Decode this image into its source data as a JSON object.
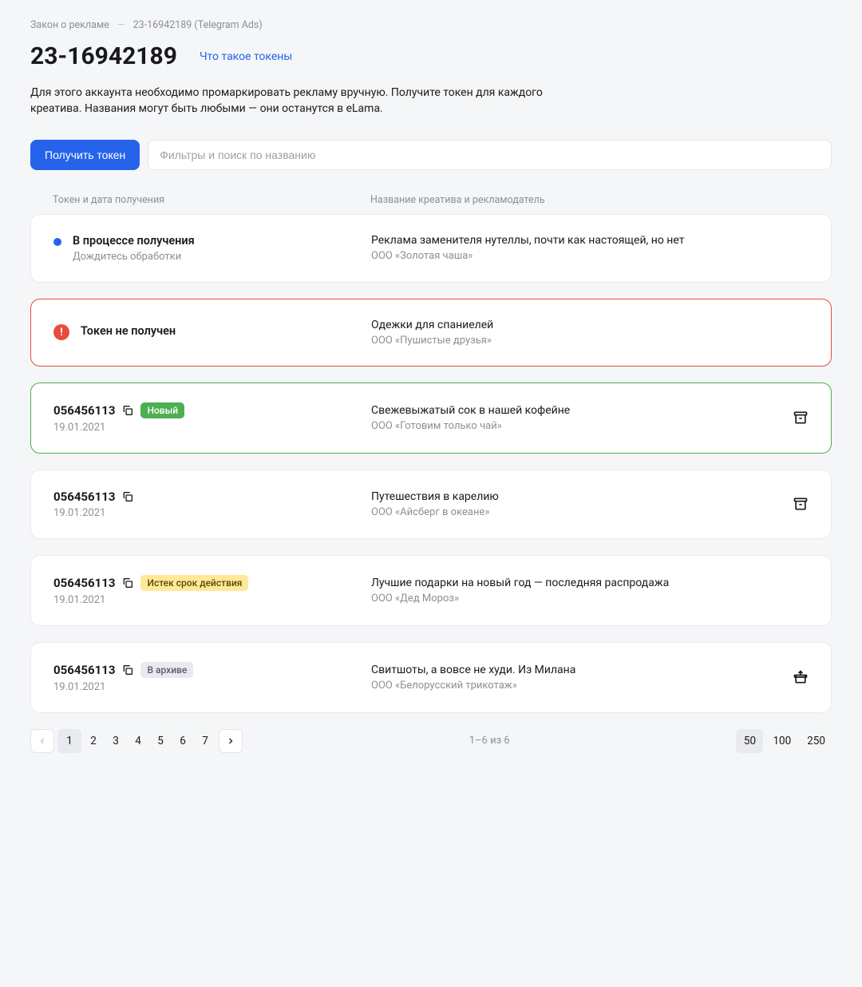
{
  "breadcrumb": {
    "root": "Закон о рекламе",
    "current": "23-16942189 (Telegram Ads)"
  },
  "header": {
    "title": "23-16942189",
    "help_link": "Что такое токены",
    "description": "Для этого аккаунта необходимо промаркировать рекламу вручную. Получите токен для каждого креатива. Названия могут быть любыми — они останутся в eLama."
  },
  "controls": {
    "get_token_label": "Получить токен",
    "search_placeholder": "Фильтры и поиск по названию"
  },
  "columns": {
    "token": "Токен и дата получения",
    "creative": "Название креатива и рекламодатель"
  },
  "rows": [
    {
      "state": "pending",
      "title": "В процессе получения",
      "subtitle": "Дождитесь обработки",
      "creative": "Реклама заменителя нутеллы, почти как настоящей, но нет",
      "advertiser": "ООО «Золотая чаша»",
      "action": null
    },
    {
      "state": "error",
      "title": "Токен не получен",
      "subtitle": "",
      "creative": "Одежки для спаниелей",
      "advertiser": "ООО «Пушистые друзья»",
      "action": null
    },
    {
      "state": "new",
      "token": "056456113",
      "date": "19.01.2021",
      "badge": "Новый",
      "creative": "Свежевыжатый сок в нашей кофейне",
      "advertiser": "ООО «Готовим только чай»",
      "action": "archive"
    },
    {
      "state": "normal",
      "token": "056456113",
      "date": "19.01.2021",
      "badge": null,
      "creative": "Путешествия в карелию",
      "advertiser": "ООО «Айсберг в океане»",
      "action": "archive"
    },
    {
      "state": "normal",
      "token": "056456113",
      "date": "19.01.2021",
      "badge": "Истек срок действия",
      "badge_style": "yellow",
      "creative": "Лучшие подарки на новый год — последняя распродажа",
      "advertiser": "ООО «Дед Мороз»",
      "action": null
    },
    {
      "state": "normal",
      "token": "056456113",
      "date": "19.01.2021",
      "badge": "В архиве",
      "badge_style": "gray",
      "creative": "Свитшоты, а вовсе не худи. Из Милана",
      "advertiser": "ООО «Белорусский трикотаж»",
      "action": "unarchive"
    }
  ],
  "pagination": {
    "pages": [
      "1",
      "2",
      "3",
      "4",
      "5",
      "6",
      "7"
    ],
    "active": "1",
    "info": "1–6 из 6",
    "per_page": [
      "50",
      "100",
      "250"
    ],
    "per_page_active": "50"
  }
}
